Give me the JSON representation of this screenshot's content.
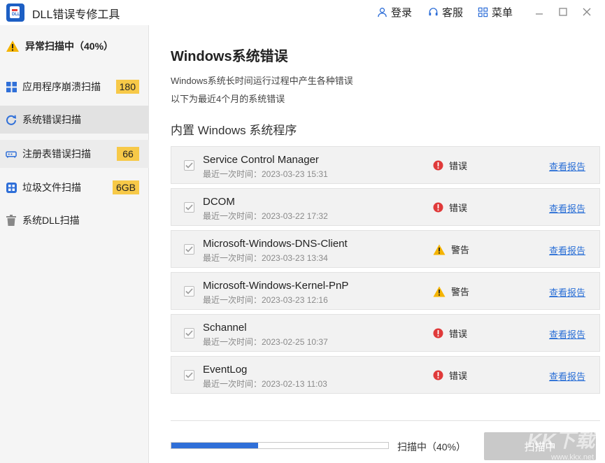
{
  "app": {
    "title": "DLL错误专修工具",
    "logo_text": "DLL"
  },
  "topbar": {
    "login": "登录",
    "service": "客服",
    "menu": "菜单"
  },
  "sidebar": {
    "status": "异常扫描中（40%）",
    "items": [
      {
        "label": "应用程序崩溃扫描",
        "badge": "180",
        "icon": "grid-icon"
      },
      {
        "label": "系统错误扫描",
        "badge": "",
        "icon": "refresh-icon"
      },
      {
        "label": "注册表错误扫描",
        "badge": "66",
        "icon": "registry-icon"
      },
      {
        "label": "垃圾文件扫描",
        "badge": "6GB",
        "icon": "apps-icon"
      },
      {
        "label": "系统DLL扫描",
        "badge": "",
        "icon": "trash-icon"
      }
    ]
  },
  "main": {
    "title": "Windows系统错误",
    "desc1": "Windows系统长时间运行过程中产生各种错误",
    "desc2": "以下为最近4个月的系统错误",
    "section": "内置 Windows 系统程序",
    "time_prefix": "最近一次时间：",
    "items": [
      {
        "name": "Service Control Manager",
        "time": "最近一次时间：2023-03-23 15:31",
        "status": "错误",
        "type": "error",
        "link": "查看报告"
      },
      {
        "name": "DCOM",
        "time": "最近一次时间：2023-03-22 17:32",
        "status": "错误",
        "type": "error",
        "link": "查看报告"
      },
      {
        "name": "Microsoft-Windows-DNS-Client",
        "time": "最近一次时间：2023-03-23 13:34",
        "status": "警告",
        "type": "warning",
        "link": "查看报告"
      },
      {
        "name": "Microsoft-Windows-Kernel-PnP",
        "time": "最近一次时间：2023-03-23 12:16",
        "status": "警告",
        "type": "warning",
        "link": "查看报告"
      },
      {
        "name": "Schannel",
        "time": "最近一次时间：2023-02-25 10:37",
        "status": "错误",
        "type": "error",
        "link": "查看报告"
      },
      {
        "name": "EventLog",
        "time": "最近一次时间：2023-02-13 11:03",
        "status": "错误",
        "type": "error",
        "link": "查看报告"
      }
    ]
  },
  "footer": {
    "progress": 0.4,
    "progress_text": "扫描中（40%）",
    "scan_button": "扫描中"
  },
  "colors": {
    "accent": "#2f6fd8",
    "badge": "#f7c948",
    "error": "#e03a3a",
    "warning": "#f5b400"
  }
}
